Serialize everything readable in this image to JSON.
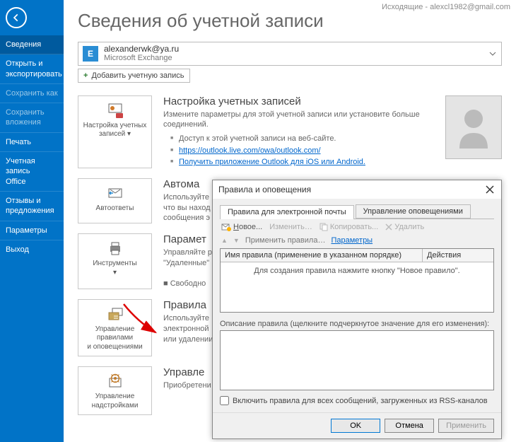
{
  "window_title": "Исходящие - alexcl1982@gmail.com",
  "page_title": "Сведения об учетной записи",
  "account": {
    "email": "alexanderwk@ya.ru",
    "type": "Microsoft Exchange"
  },
  "add_account": "Добавить учетную запись",
  "sidebar": [
    {
      "label": "Сведения",
      "selected": true,
      "dim": false
    },
    {
      "label": "Открыть и\nэкспортировать",
      "selected": false,
      "dim": false
    },
    {
      "label": "Сохранить как",
      "selected": false,
      "dim": true
    },
    {
      "label": "Сохранить\nвложения",
      "selected": false,
      "dim": true
    },
    {
      "label": "Печать",
      "selected": false,
      "dim": false
    },
    {
      "label": "Учетная\nзапись\nOffice",
      "selected": false,
      "dim": false
    },
    {
      "label": "Отзывы и\nпредложения",
      "selected": false,
      "dim": false
    },
    {
      "label": "Параметры",
      "selected": false,
      "dim": false
    },
    {
      "label": "Выход",
      "selected": false,
      "dim": false
    }
  ],
  "sections": {
    "account_settings": {
      "tile": "Настройка учетных\nзаписей ▾",
      "title": "Настройка учетных записей",
      "desc": "Измените параметры для этой учетной записи или установите больше соединений.",
      "bullets": [
        {
          "text": "Доступ к этой учетной записи на веб-сайте."
        },
        {
          "link": "https://outlook.live.com/owa/outlook.com/"
        },
        {
          "link": "Получить приложение Outlook для iOS или Android."
        }
      ]
    },
    "auto_replies": {
      "tile": "Автоответы",
      "title": "Автома",
      "desc": "Используйте\nчто вы наход\nсообщения э"
    },
    "tools": {
      "tile": "Инструменты\n▾",
      "title": "Парамет",
      "desc": "Управляйте р\n\"Удаленные\"",
      "extra": "Свободно"
    },
    "rules": {
      "tile": "Управление правилами\nи оповещениями",
      "title": "Правила",
      "desc": "Используйте\nэлектронной\nили удалении"
    },
    "addins": {
      "tile": "Управление\nнадстройками",
      "title": "Управле",
      "desc": "Приобретени"
    }
  },
  "dialog": {
    "title": "Правила и оповещения",
    "tabs": [
      "Правила для электронной почты",
      "Управление оповещениями"
    ],
    "toolbar": {
      "new": "Новое...",
      "change": "Изменить…",
      "copy": "Копировать...",
      "delete": "Удалить"
    },
    "subtoolbar": {
      "apply": "Применить правила…",
      "params": "Параметры"
    },
    "table_headers": [
      "Имя правила (применение в указанном порядке)",
      "Действия"
    ],
    "empty_msg": "Для создания правила нажмите кнопку \"Новое правило\".",
    "desc_label": "Описание правила (щелкните подчеркнутое значение для его изменения):",
    "checkbox": "Включить правила для всех сообщений, загруженных из RSS-каналов",
    "buttons": {
      "ok": "OK",
      "cancel": "Отмена",
      "apply": "Применить"
    }
  }
}
